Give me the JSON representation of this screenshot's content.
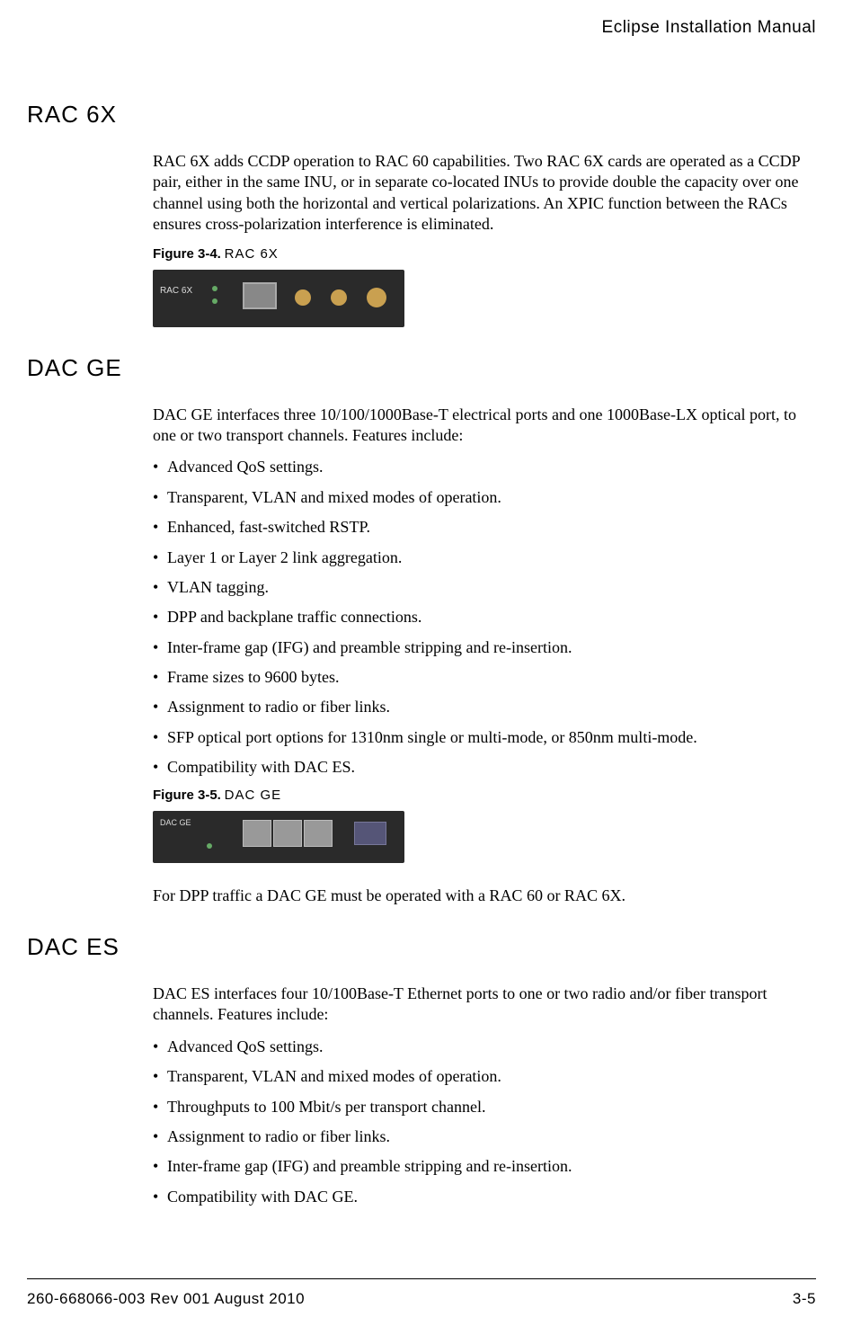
{
  "header": {
    "title": "Eclipse Installation Manual"
  },
  "sections": {
    "rac6x": {
      "heading": "RAC 6X",
      "body": "RAC 6X adds CCDP operation to RAC 60 capabilities. Two RAC 6X cards are operated as a CCDP pair, either in the same INU, or in separate co-located INUs to provide double the capacity over one channel using both the horizontal and vertical polarizations. An XPIC function between the RACs ensures cross-polarization interference is eliminated.",
      "figure_label_bold": "Figure 3-4.",
      "figure_label_text": "RAC 6X"
    },
    "dacge": {
      "heading": "DAC GE",
      "body": "DAC GE interfaces three 10/100/1000Base-T electrical ports and one 1000Base-LX optical port, to one or two transport channels. Features include:",
      "bullets": [
        "Advanced QoS settings.",
        "Transparent, VLAN and mixed modes of operation.",
        "Enhanced, fast-switched RSTP.",
        "Layer 1 or Layer 2 link aggregation.",
        "VLAN tagging.",
        "DPP and backplane traffic connections.",
        "Inter-frame gap (IFG) and preamble stripping and re-insertion.",
        "Frame sizes to 9600 bytes.",
        "Assignment to radio or fiber links.",
        "SFP optical port options for 1310nm single or multi-mode, or 850nm multi-mode.",
        "Compatibility with DAC ES."
      ],
      "figure_label_bold": "Figure 3-5.",
      "figure_label_text": "DAC GE",
      "footnote": "For DPP traffic a DAC GE must be operated with a RAC 60 or RAC 6X."
    },
    "daces": {
      "heading": "DAC ES",
      "body": "DAC ES interfaces four 10/100Base-T Ethernet ports to one or two radio and/or fiber transport channels. Features include:",
      "bullets": [
        "Advanced QoS settings.",
        "Transparent, VLAN and mixed modes of operation.",
        "Throughputs to 100 Mbit/s per transport channel.",
        "Assignment to radio or fiber links.",
        "Inter-frame gap (IFG) and preamble stripping and re-insertion.",
        "Compatibility with DAC GE."
      ]
    }
  },
  "footer": {
    "left": "260-668066-003 Rev 001 August 2010",
    "right": "3-5"
  }
}
